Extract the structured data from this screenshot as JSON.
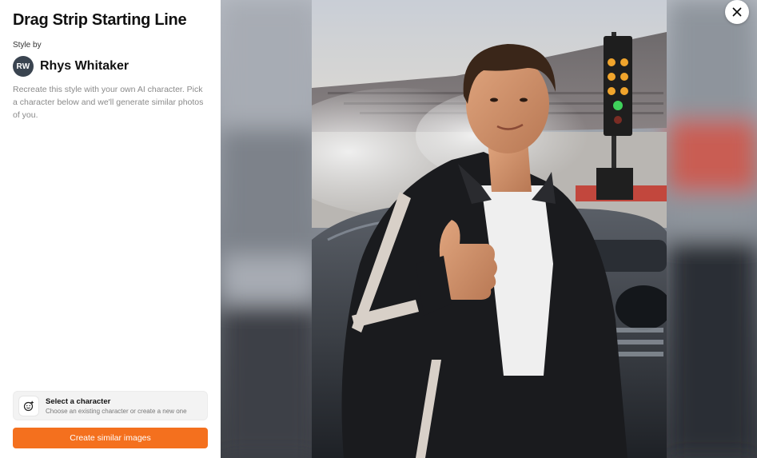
{
  "style": {
    "title": "Drag Strip Starting Line",
    "style_by_label": "Style by",
    "author": {
      "initials": "RW",
      "name": "Rhys Whitaker"
    },
    "description": "Recreate this style with your own AI character. Pick a character below and we'll generate similar photos of you."
  },
  "character_select": {
    "title": "Select a character",
    "subtitle": "Choose an existing character or create a new one",
    "icon": "face-add-icon"
  },
  "actions": {
    "create_label": "Create similar images",
    "close_icon": "close-icon"
  },
  "colors": {
    "accent": "#f4701e",
    "avatar_bg": "#3a4450"
  }
}
